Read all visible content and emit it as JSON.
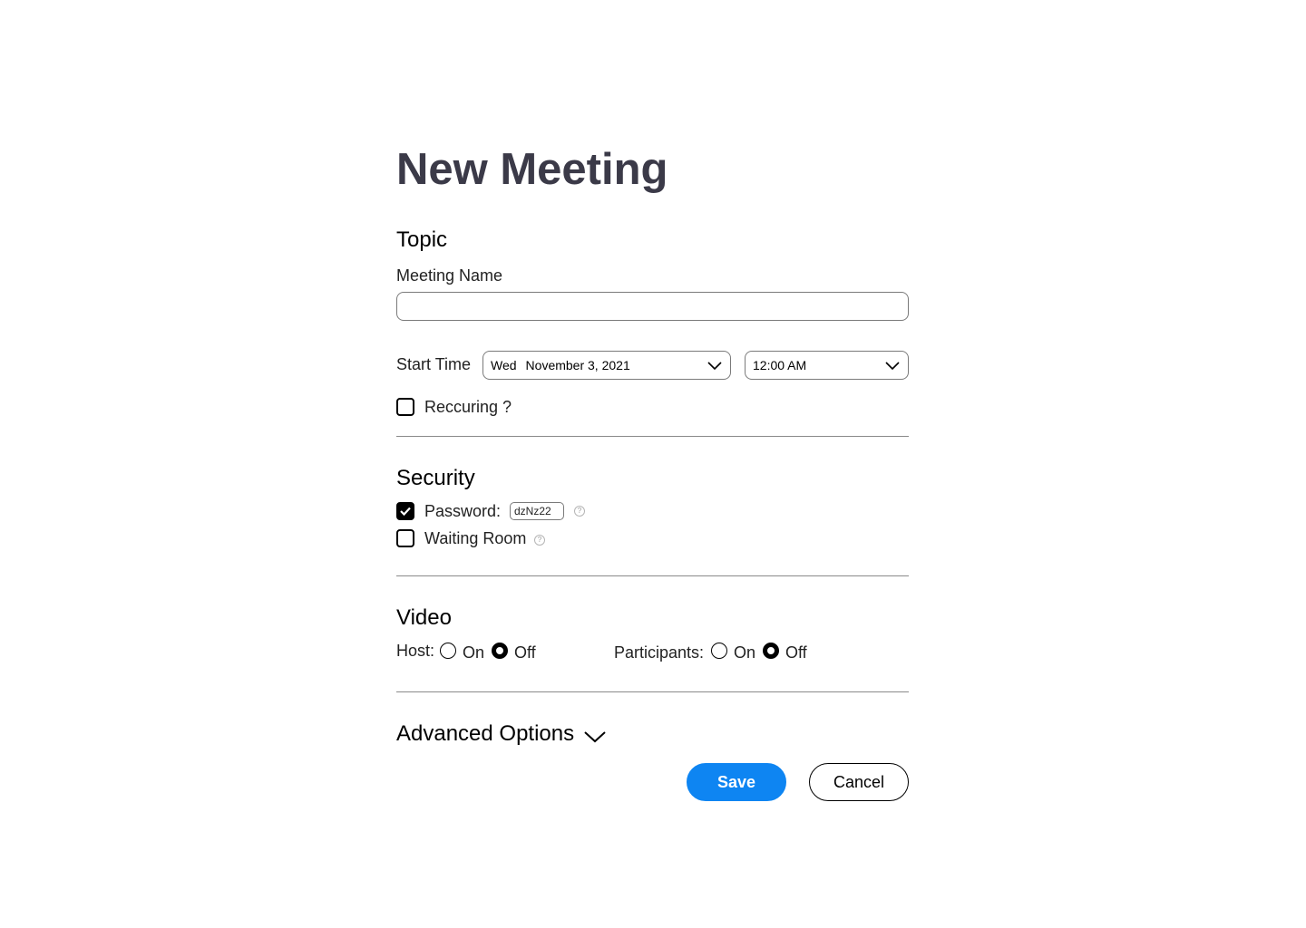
{
  "page": {
    "title": "New Meeting"
  },
  "topic": {
    "heading": "Topic",
    "meeting_name_label": "Meeting Name",
    "meeting_name_value": "",
    "meeting_name_placeholder": ""
  },
  "start_time": {
    "label": "Start Time",
    "date_day": "Wed",
    "date_value": "November 3, 2021",
    "time_value": "12:00 AM",
    "dropdown_icon": "chevron-down-icon"
  },
  "recurring": {
    "label": "Reccuring ?",
    "checked": false
  },
  "security": {
    "heading": "Security",
    "password_label": "Password:",
    "password_value": "dzNz22",
    "password_checked": true,
    "waiting_room_label": "Waiting Room",
    "waiting_room_checked": false,
    "help_icon": "help-circle-icon",
    "help_glyph": "?"
  },
  "video": {
    "heading": "Video",
    "host_label": "Host:",
    "host_on_label": "On",
    "host_off_label": "Off",
    "host_value": "Off",
    "participants_label": "Participants:",
    "participants_on_label": "On",
    "participants_off_label": "Off",
    "participants_value": "Off"
  },
  "advanced": {
    "label": "Advanced Options",
    "icon": "chevron-down-icon"
  },
  "actions": {
    "save_label": "Save",
    "cancel_label": "Cancel"
  },
  "colors": {
    "title": "#3b3a48",
    "primary_button": "#0e85f2",
    "border": "#7a7a7a",
    "divider": "#8a8a8a"
  }
}
